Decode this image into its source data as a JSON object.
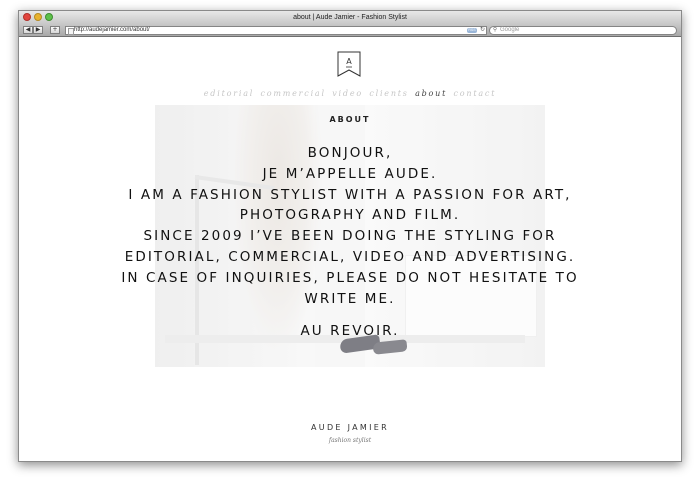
{
  "window": {
    "title": "about | Aude Jamier - Fashion Stylist"
  },
  "toolbar": {
    "back": "◀",
    "forward": "▶",
    "add": "+",
    "url": "http://audejamier.com/about/",
    "rss": "RSS",
    "reload": "↻",
    "search_placeholder": "Google"
  },
  "logo": {
    "letter": "A"
  },
  "nav": {
    "items": [
      "editorial",
      "commercial",
      "video",
      "clients",
      "about",
      "contact"
    ],
    "active": "about"
  },
  "about": {
    "heading": "ABOUT",
    "lines": [
      "BONJOUR,",
      "JE M’APPELLE AUDE.",
      "I AM A FASHION STYLIST WITH A PASSION FOR ART,",
      "PHOTOGRAPHY AND FILM.",
      "SINCE 2009 I’VE BEEN DOING THE STYLING FOR",
      "EDITORIAL, COMMERCIAL, VIDEO AND ADVERTISING.",
      "IN CASE OF INQUIRIES, PLEASE DO NOT HESITATE TO",
      "WRITE ME."
    ],
    "closing": "AU REVOIR."
  },
  "footer": {
    "name": "AUDE JAMIER",
    "subtitle": "fashion stylist"
  },
  "colors": {
    "nav_inactive": "#c6c6c6",
    "nav_active": "#444444",
    "text": "#111111"
  }
}
